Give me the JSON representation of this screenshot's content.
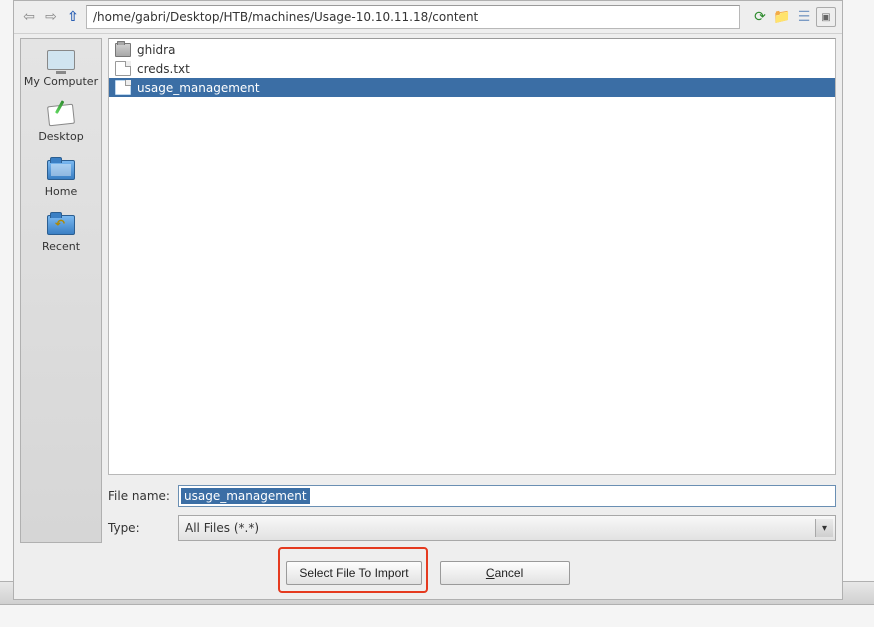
{
  "toolbar": {
    "path": "/home/gabri/Desktop/HTB/machines/Usage-10.10.11.18/content"
  },
  "sidebar": {
    "items": [
      {
        "label": "My Computer"
      },
      {
        "label": "Desktop"
      },
      {
        "label": "Home"
      },
      {
        "label": "Recent"
      }
    ]
  },
  "files": {
    "items": [
      {
        "name": "ghidra",
        "kind": "folder",
        "selected": false
      },
      {
        "name": "creds.txt",
        "kind": "file",
        "selected": false
      },
      {
        "name": "usage_management",
        "kind": "file",
        "selected": true
      }
    ]
  },
  "form": {
    "filename_label": "File name:",
    "filename_value": "usage_management",
    "type_label": "Type:",
    "type_value": "All Files (*.*)"
  },
  "buttons": {
    "import_label": "Select File To Import",
    "cancel_pre": "",
    "cancel_ul": "C",
    "cancel_post": "ancel"
  }
}
